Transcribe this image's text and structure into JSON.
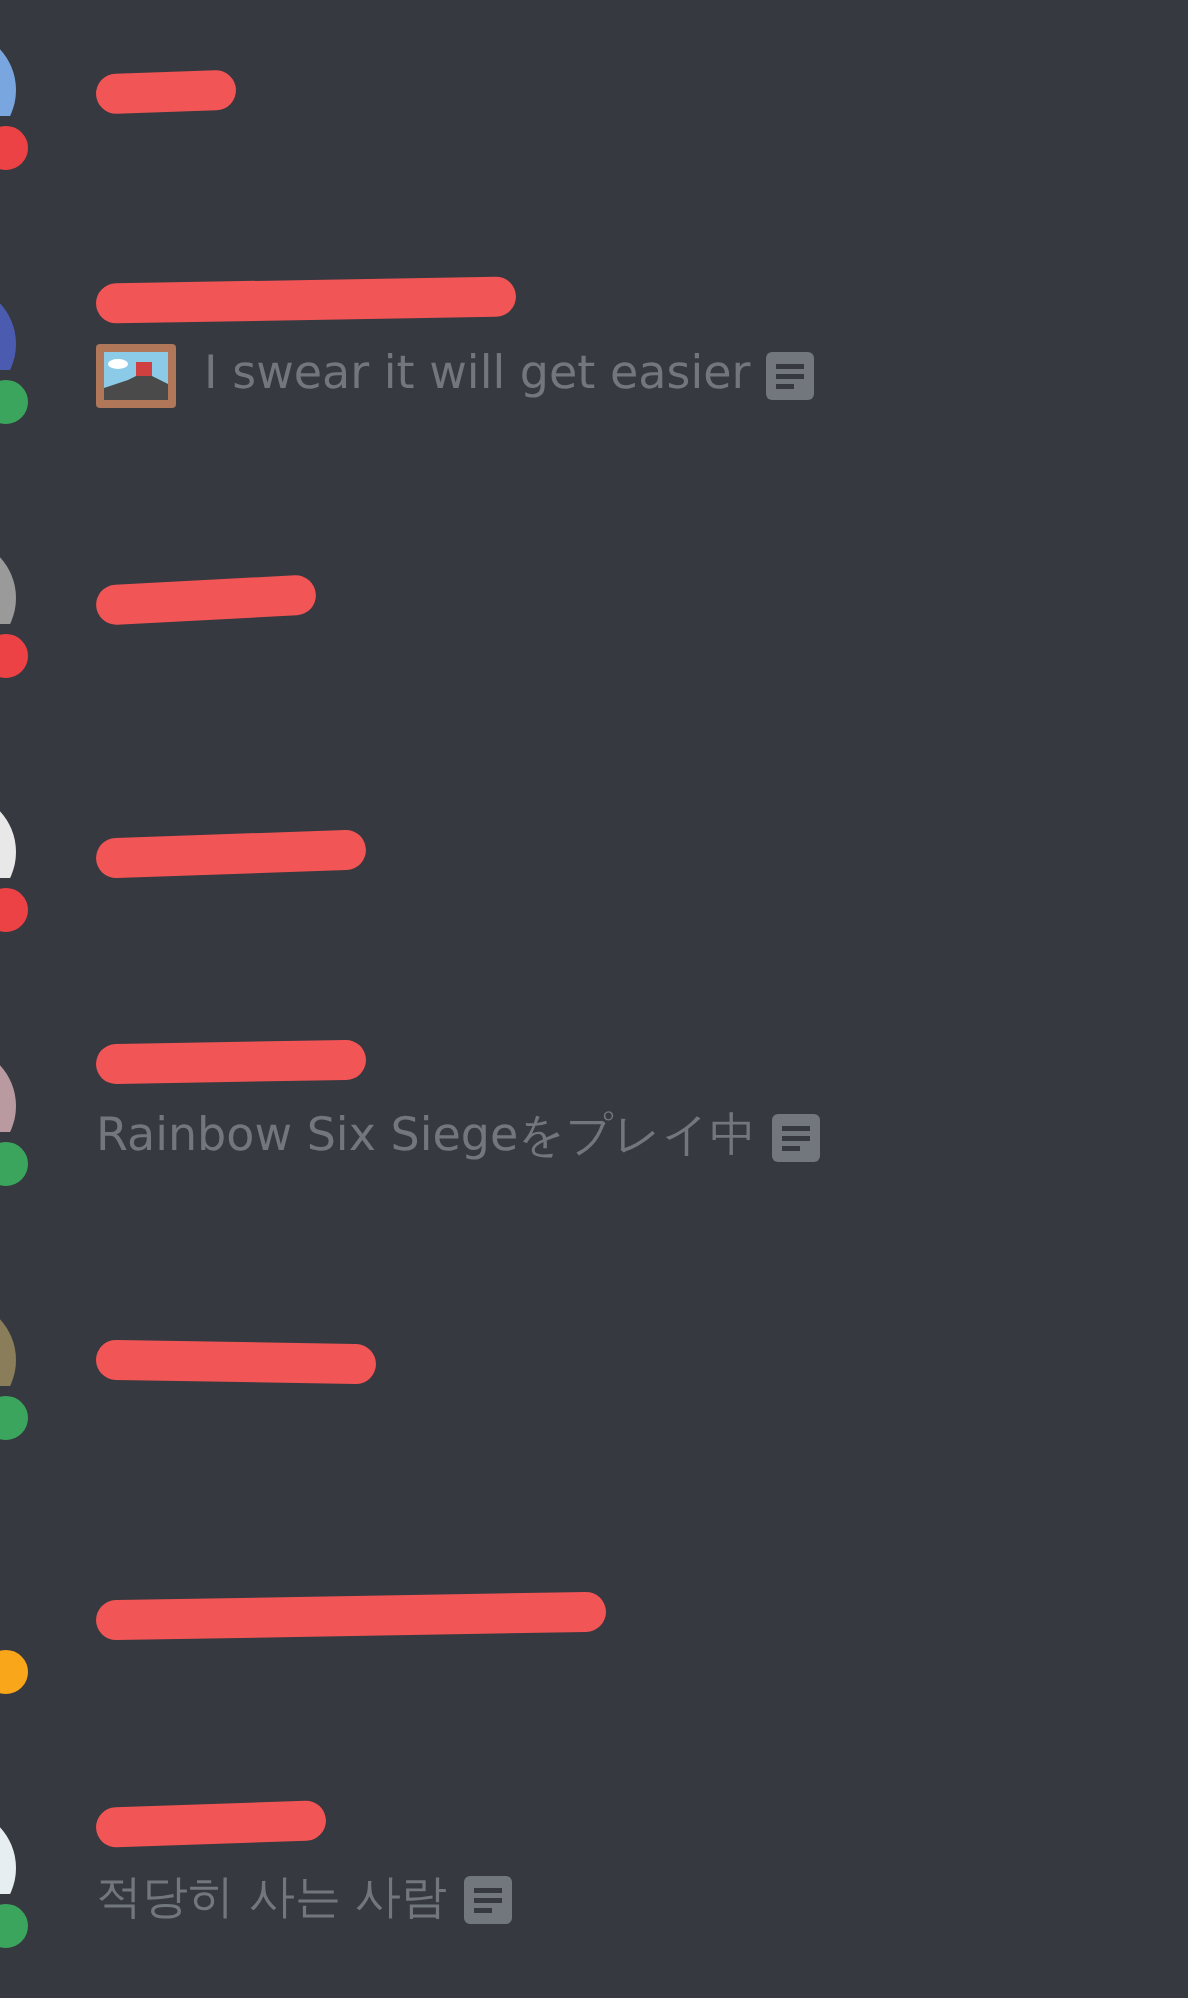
{
  "members": [
    {
      "color": "#ed4245",
      "name_redacted": true
    },
    {
      "color": "#3ba55d",
      "name_redacted": true,
      "activity": {
        "kind": "custom",
        "text": "I swear it will get easier"
      }
    },
    {
      "color": "#ed4245",
      "name_redacted": true
    },
    {
      "color": "#ed4245",
      "name_redacted": true
    },
    {
      "color": "#3ba55d",
      "name_redacted": true,
      "activity": {
        "kind": "game",
        "text": "Rainbow Six Siegeをプレイ中"
      }
    },
    {
      "color": "#3ba55d",
      "name_redacted": true
    },
    {
      "color": "#faa61a",
      "name_redacted": true
    },
    {
      "color": "#3ba55d",
      "name_redacted": true,
      "activity": {
        "kind": "game",
        "text": "적당히 사는 사람"
      }
    }
  ]
}
